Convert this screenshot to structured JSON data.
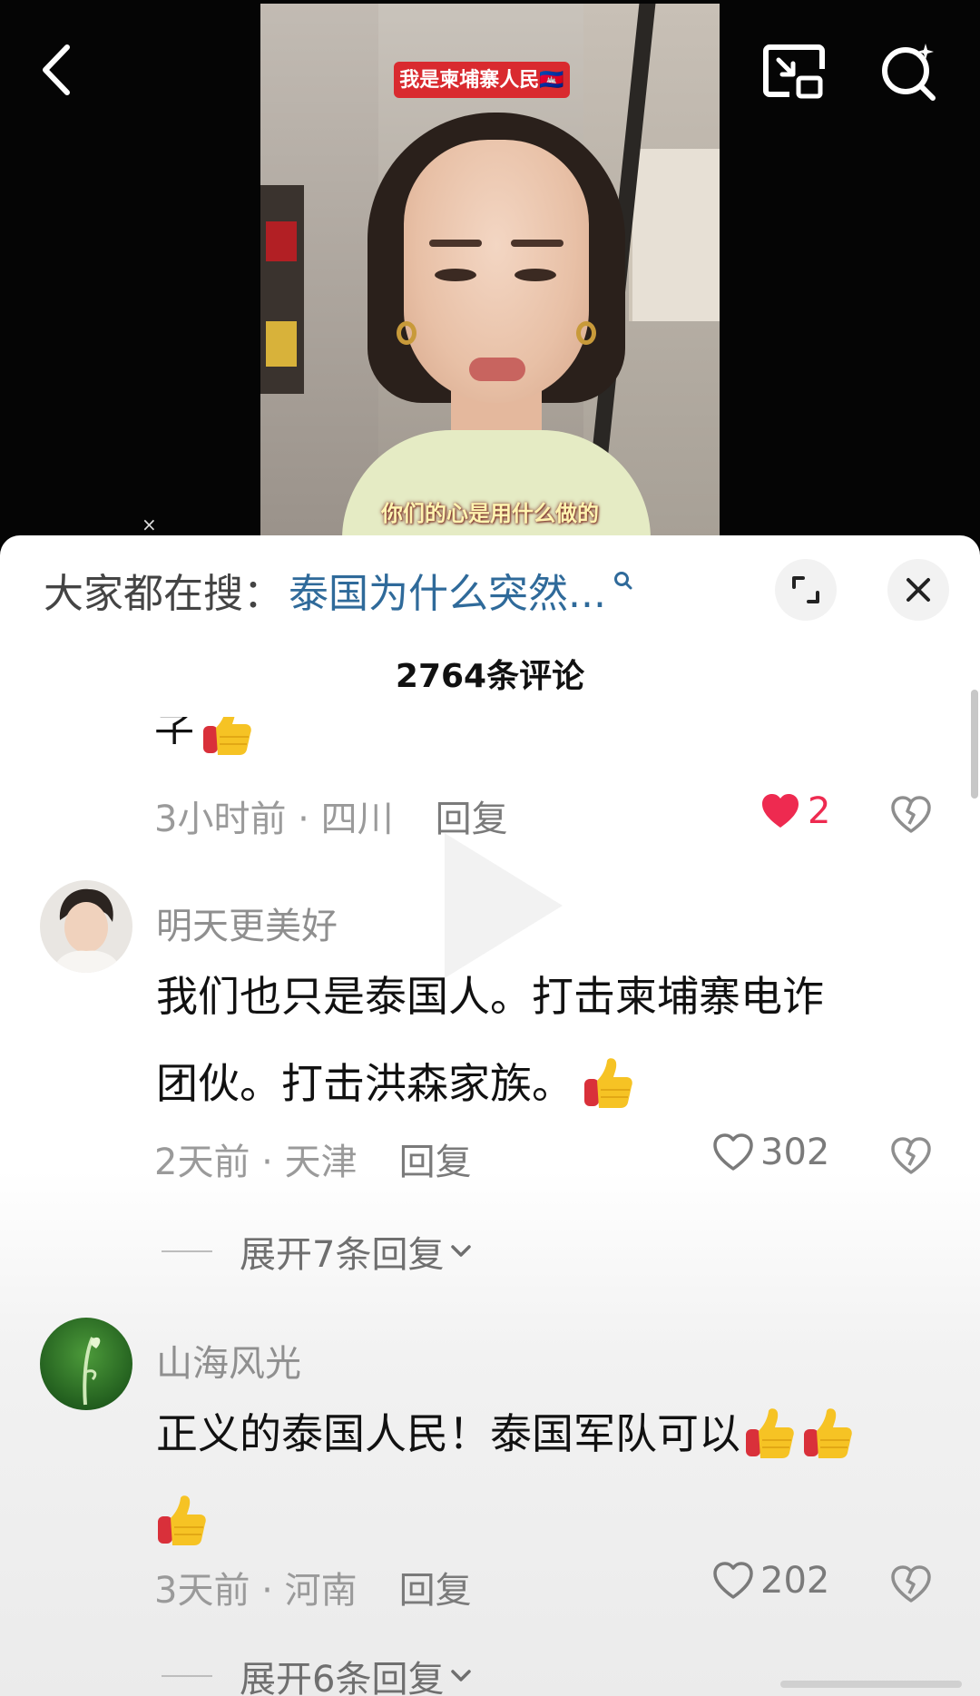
{
  "video": {
    "title_tag": "我是柬埔寨人民🇰🇭",
    "caption": "你们的心是用什么做的"
  },
  "toolbar": {
    "back_icon": "chevron-left-icon",
    "pip_icon": "picture-in-picture-icon",
    "search_icon": "search-sparkle-icon",
    "close_small": "×"
  },
  "panel": {
    "search_prefix": "大家都在搜：",
    "search_query": "泰国为什么突然...",
    "comment_count": "2764条评论",
    "expand_icon": "expand-icon",
    "close_icon": "×"
  },
  "comments": [
    {
      "cut_text": "子",
      "time_location": "3小时前 · 四川",
      "reply_label": "回复",
      "likes": "2",
      "liked": true
    },
    {
      "username": "明天更美好",
      "text_line1": "我们也只是泰国人。打击柬埔寨电诈",
      "text_line2": "团伙。打击洪森家族。",
      "time_location": "2天前 · 天津",
      "reply_label": "回复",
      "likes": "302",
      "liked": false,
      "expand_label": "展开7条回复"
    },
    {
      "username": "山海风光",
      "text_line1": "正义的泰国人民！泰国军队可以",
      "time_location": "3天前 · 河南",
      "reply_label": "回复",
      "likes": "202",
      "liked": false,
      "expand_label": "展开6条回复"
    }
  ],
  "colors": {
    "accent_red": "#ee2a50",
    "search_blue": "#2f6a9a",
    "muted_gray": "#9a9a9a"
  }
}
